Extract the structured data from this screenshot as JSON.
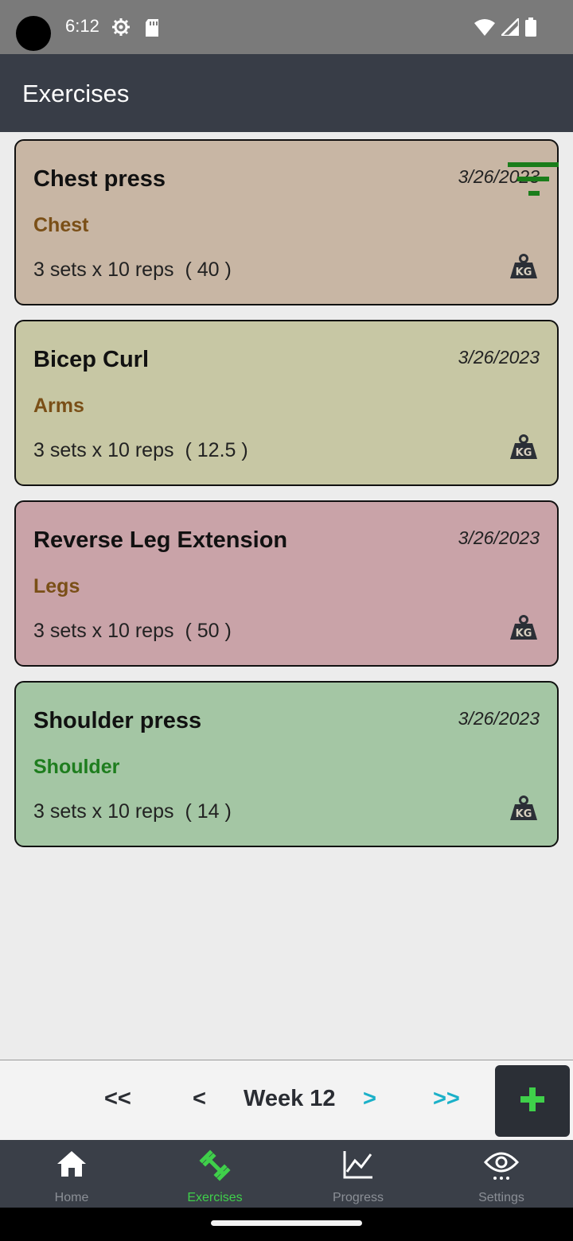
{
  "status_bar": {
    "time": "6:12"
  },
  "app_bar": {
    "title": "Exercises"
  },
  "exercises": [
    {
      "name": "Chest press",
      "date": "3/26/2023",
      "category": "Chest",
      "sets": "3 sets x 10 reps",
      "weight": "( 40 )",
      "bg": "#c8b6a4",
      "category_color": "#7a4f17"
    },
    {
      "name": "Bicep Curl",
      "date": "3/26/2023",
      "category": "Arms",
      "sets": "3 sets x 10 reps",
      "weight": "( 12.5 )",
      "bg": "#c7c7a4",
      "category_color": "#7a4f17"
    },
    {
      "name": "Reverse Leg Extension",
      "date": "3/26/2023",
      "category": "Legs",
      "sets": "3 sets x 10 reps",
      "weight": "( 50 )",
      "bg": "#c9a3a8",
      "category_color": "#7a4f17"
    },
    {
      "name": "Shoulder press",
      "date": "3/26/2023",
      "category": "Shoulder",
      "sets": "3 sets x 10 reps",
      "weight": "( 14 )",
      "bg": "#a4c6a4",
      "category_color": "#1e7d1e"
    }
  ],
  "pager": {
    "first": "<<",
    "prev": "<",
    "week": "Week 12",
    "next": ">",
    "last": ">>"
  },
  "nav": [
    {
      "label": "Home",
      "icon": "home-icon"
    },
    {
      "label": "Exercises",
      "icon": "dumbbell-icon",
      "active": true
    },
    {
      "label": "Progress",
      "icon": "chart-icon"
    },
    {
      "label": "Settings",
      "icon": "eye-icon"
    }
  ],
  "colors": {
    "accent_green": "#3fd04a",
    "pager_teal": "#1ab0c8",
    "app_bar": "#383d47"
  }
}
